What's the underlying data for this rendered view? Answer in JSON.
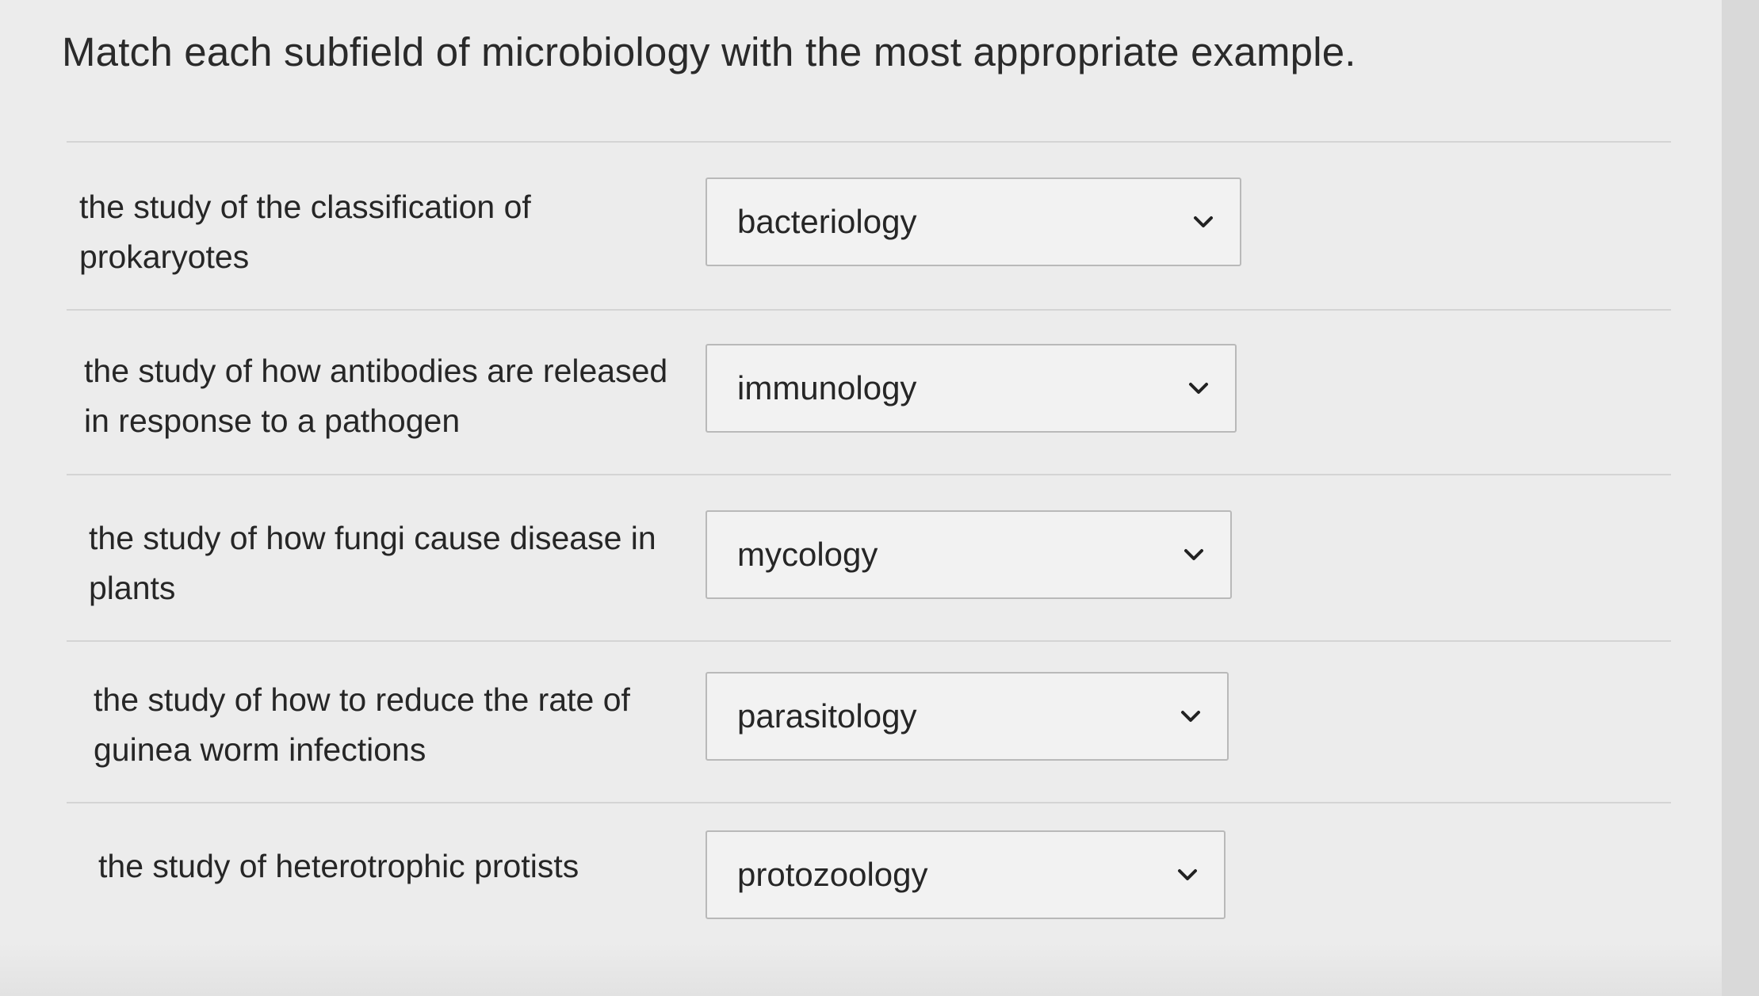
{
  "question": {
    "title": "Match each subfield of microbiology with the most appropriate example."
  },
  "rows": [
    {
      "prompt_line1": "the study of the classification of",
      "prompt_line2": "prokaryotes",
      "selected": "bacteriology"
    },
    {
      "prompt_line1": "the study of how antibodies are released",
      "prompt_line2": "in response to a pathogen",
      "selected": "immunology"
    },
    {
      "prompt_line1": "the study of how fungi cause disease in",
      "prompt_line2": "plants",
      "selected": "mycology"
    },
    {
      "prompt_line1": "the study of how to reduce the rate of",
      "prompt_line2": "guinea worm infections",
      "selected": "parasitology"
    },
    {
      "prompt_line1": "the study of heterotrophic protists",
      "prompt_line2": "",
      "selected": "protozoology"
    }
  ],
  "icons": {
    "dropdown": "chevron-down-icon"
  }
}
